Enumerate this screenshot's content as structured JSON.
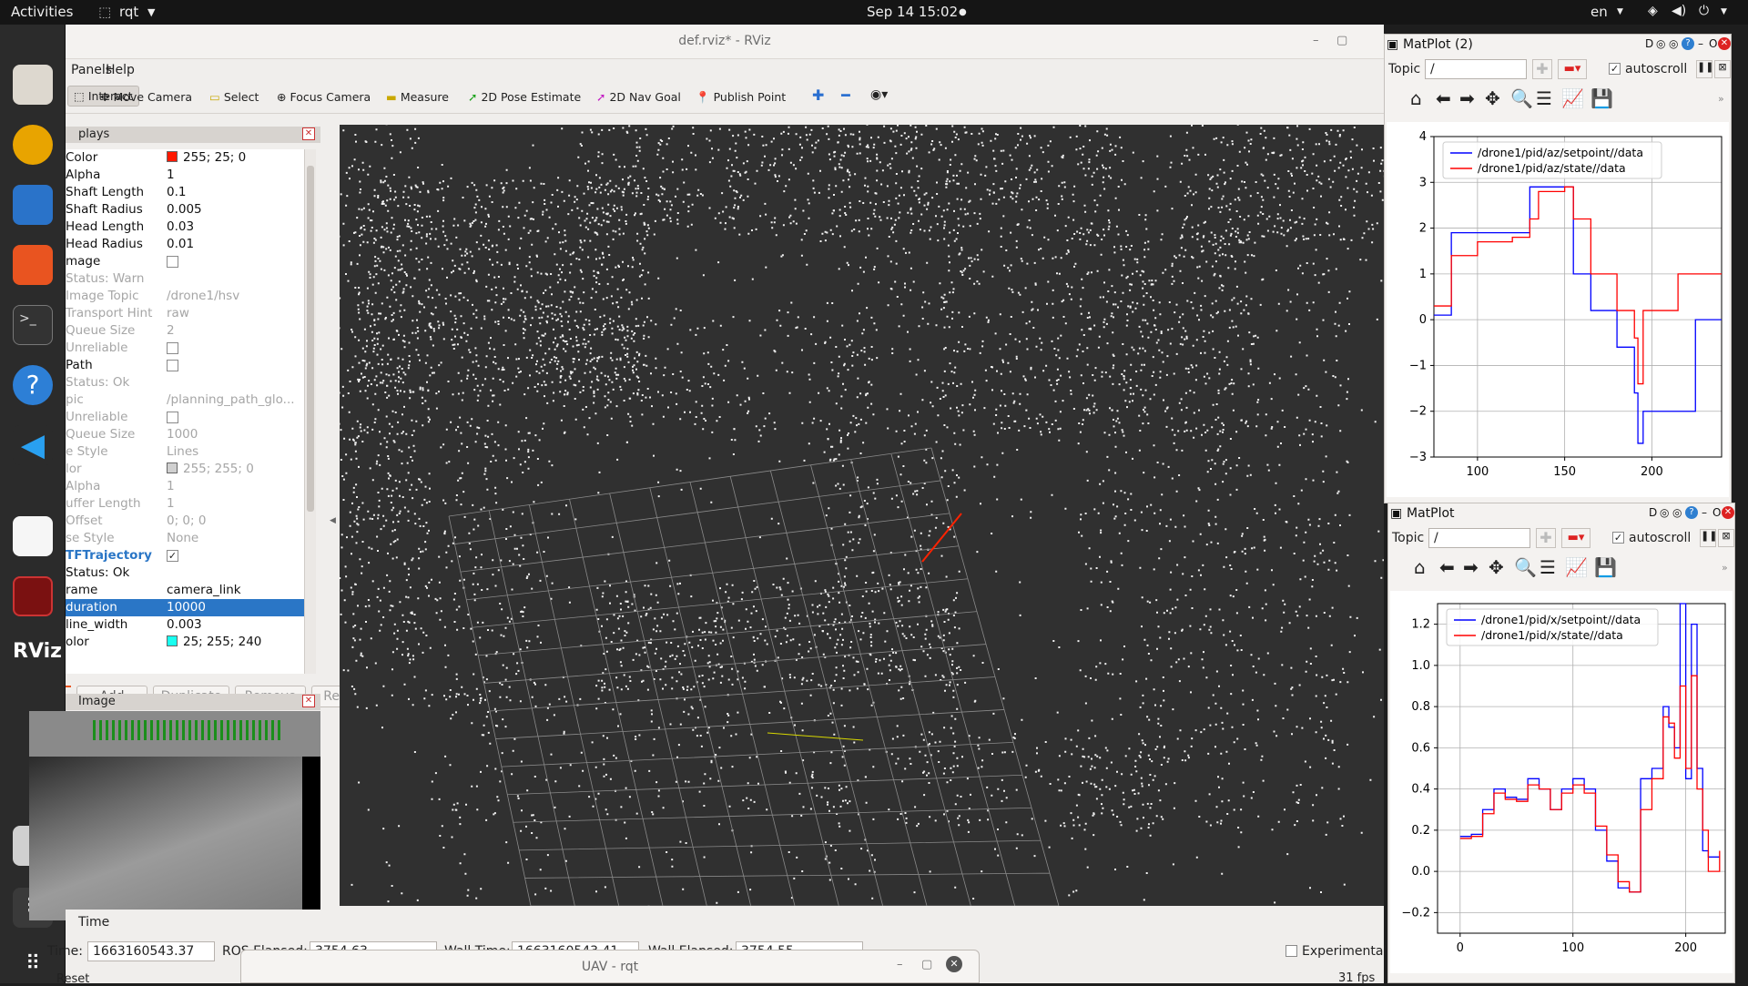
{
  "topbar": {
    "activities": "Activities",
    "app": "rqt",
    "clock": "Sep 14  15:02",
    "lang": "en"
  },
  "rviz": {
    "title": "def.rviz* - RViz",
    "menu": {
      "panels": "Panels",
      "help": "Help"
    },
    "tools": [
      "Interact",
      "Move Camera",
      "Select",
      "Focus Camera",
      "Measure",
      "2D Pose Estimate",
      "2D Nav Goal",
      "Publish Point"
    ],
    "displays_title": "plays",
    "properties": [
      {
        "k": "Color",
        "v": "255; 25; 0",
        "swatch": "#ff1900",
        "dis": false
      },
      {
        "k": "Alpha",
        "v": "1",
        "dis": false
      },
      {
        "k": "Shaft Length",
        "v": "0.1",
        "dis": false
      },
      {
        "k": "Shaft Radius",
        "v": "0.005",
        "dis": false
      },
      {
        "k": "Head Length",
        "v": "0.03",
        "dis": false
      },
      {
        "k": "Head Radius",
        "v": "0.01",
        "dis": false
      },
      {
        "k": "mage",
        "v": "",
        "check": "",
        "dis": false
      },
      {
        "k": "Status: Warn",
        "v": "",
        "dis": true
      },
      {
        "k": "Image Topic",
        "v": "/drone1/hsv",
        "dis": true
      },
      {
        "k": "Transport Hint",
        "v": "raw",
        "dis": true
      },
      {
        "k": "Queue Size",
        "v": "2",
        "dis": true
      },
      {
        "k": "Unreliable",
        "v": "",
        "check": "",
        "dis": true
      },
      {
        "k": "Path",
        "v": "",
        "check": "",
        "dis": false
      },
      {
        "k": "Status: Ok",
        "v": "",
        "dis": true
      },
      {
        "k": "pic",
        "v": "/planning_path_glo...",
        "dis": true
      },
      {
        "k": "Unreliable",
        "v": "",
        "check": "",
        "dis": true
      },
      {
        "k": "Queue Size",
        "v": "1000",
        "dis": true
      },
      {
        "k": "e Style",
        "v": "Lines",
        "dis": true
      },
      {
        "k": "lor",
        "v": "255; 255; 0",
        "swatch": "#d0d0d0",
        "dis": true
      },
      {
        "k": "Alpha",
        "v": "1",
        "dis": true
      },
      {
        "k": "uffer Length",
        "v": "1",
        "dis": true
      },
      {
        "k": "Offset",
        "v": "0; 0; 0",
        "dis": true
      },
      {
        "k": "se Style",
        "v": "None",
        "dis": true
      },
      {
        "k": "TFTrajectory",
        "v": "",
        "check": "✓",
        "dis": false,
        "link": true
      },
      {
        "k": "Status: Ok",
        "v": "",
        "dis": false
      },
      {
        "k": "rame",
        "v": "camera_link",
        "dis": false
      },
      {
        "k": "duration",
        "v": "10000",
        "dis": false,
        "sel": true
      },
      {
        "k": "line_width",
        "v": "0.003",
        "dis": false
      },
      {
        "k": "olor",
        "v": "25; 255; 240",
        "swatch": "#19fff0",
        "dis": false
      }
    ],
    "buttons": {
      "add": "Add",
      "duplicate": "Duplicate",
      "remove": "Remove",
      "rename": "Rename"
    },
    "image_panel_title": "Image",
    "time": {
      "panel_title": "Time",
      "ros_time_label": "Time:",
      "ros_time": "1663160543.37",
      "ros_elapsed_label": "ROS Elapsed:",
      "ros_elapsed": "3754.63",
      "wall_time_label": "Wall Time:",
      "wall_time": "1663160543.41",
      "wall_elapsed_label": "Wall Elapsed:",
      "wall_elapsed": "3754.55",
      "experimental": "Experimental",
      "reset": "Reset",
      "fps": "31 fps"
    }
  },
  "rqt_window": {
    "title": "UAV - rqt"
  },
  "matplots": [
    {
      "title": "MatPlot (2)",
      "topic_label": "Topic",
      "topic_value": "/",
      "autoscroll": "autoscroll",
      "chart_data": {
        "type": "line",
        "x": [
          75,
          85,
          100,
          120,
          130,
          135,
          150,
          155,
          165,
          180,
          190,
          192,
          195,
          200,
          215,
          225,
          240
        ],
        "series": [
          {
            "name": "/drone1/pid/az/setpoint//data",
            "color": "#0000ff",
            "values": [
              0.1,
              1.9,
              1.9,
              1.9,
              2.9,
              2.9,
              2.9,
              1,
              0.2,
              -0.6,
              -1.6,
              -2.7,
              -2,
              -2,
              -2,
              0,
              0
            ]
          },
          {
            "name": "/drone1/pid/az/state//data",
            "color": "#ff0000",
            "values": [
              0.3,
              1.4,
              1.7,
              1.8,
              2.2,
              2.8,
              2.9,
              2.2,
              1.0,
              0.2,
              -0.4,
              -1.4,
              0.2,
              0.2,
              1,
              1,
              1
            ]
          }
        ],
        "xticks": [
          100,
          150,
          200
        ],
        "yticks": [
          4,
          3,
          2,
          1,
          0,
          -1,
          -2,
          -3
        ],
        "xlim": [
          75,
          240
        ],
        "ylim": [
          -3,
          4
        ]
      }
    },
    {
      "title": "MatPlot",
      "topic_label": "Topic",
      "topic_value": "/",
      "autoscroll": "autoscroll",
      "chart_data": {
        "type": "line",
        "x": [
          0,
          10,
          20,
          30,
          40,
          50,
          60,
          70,
          80,
          90,
          100,
          110,
          120,
          130,
          140,
          150,
          160,
          170,
          180,
          185,
          190,
          195,
          200,
          205,
          210,
          215,
          220,
          230
        ],
        "series": [
          {
            "name": "/drone1/pid/x/setpoint//data",
            "color": "#0000ff",
            "values": [
              0.17,
              0.18,
              0.3,
              0.4,
              0.36,
              0.35,
              0.45,
              0.4,
              0.3,
              0.4,
              0.45,
              0.4,
              0.2,
              0.05,
              -0.08,
              -0.1,
              0.45,
              0.5,
              0.8,
              0.7,
              0.6,
              1.3,
              0.45,
              1.2,
              0.5,
              0.1,
              0.07,
              0.07
            ]
          },
          {
            "name": "/drone1/pid/x/state//data",
            "color": "#ff0000",
            "values": [
              0.16,
              0.17,
              0.28,
              0.38,
              0.35,
              0.34,
              0.42,
              0.4,
              0.3,
              0.38,
              0.42,
              0.38,
              0.22,
              0.08,
              -0.05,
              -0.1,
              0.3,
              0.45,
              0.75,
              0.72,
              0.55,
              0.9,
              0.5,
              0.95,
              0.4,
              0.2,
              0.0,
              0.1
            ]
          }
        ],
        "xticks": [
          0,
          100,
          200
        ],
        "yticks": [
          1.2,
          1.0,
          0.8,
          0.6,
          0.4,
          0.2,
          0.0,
          -0.2
        ],
        "xlim": [
          -20,
          235
        ],
        "ylim": [
          -0.3,
          1.3
        ]
      }
    }
  ]
}
